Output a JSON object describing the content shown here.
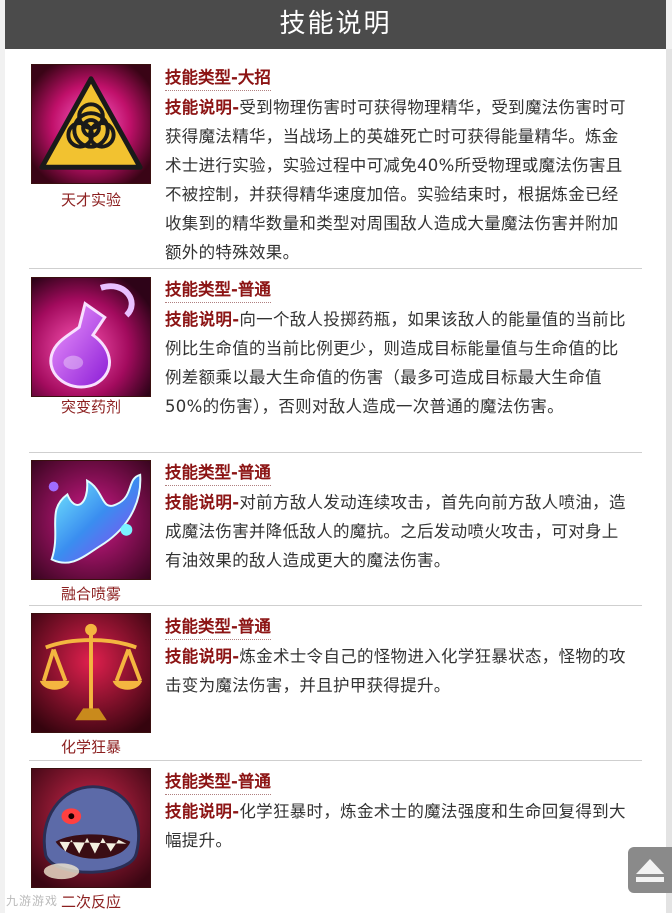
{
  "page": {
    "title": "技能说明"
  },
  "labels": {
    "type_prefix": "技能类型-",
    "desc_prefix": "技能说明-"
  },
  "skills": [
    {
      "name": "天才实验",
      "icon": "biohazard-icon",
      "type": "大招",
      "desc": "受到物理伤害时可获得物理精华，受到魔法伤害时可获得魔法精华，当战场上的英雄死亡时可获得能量精华。炼金术士进行实验，实验过程中可减免40%所受物理或魔法伤害且不被控制，并获得精华速度加倍。实验结束时，根据炼金已经收集到的精华数量和类型对周围敌人造成大量魔法伤害并附加额外的特殊效果。"
    },
    {
      "name": "突变药剂",
      "icon": "potion-flask-icon",
      "type": "普通",
      "desc": "向一个敌人投掷药瓶，如果该敌人的能量值的当前比例比生命值的当前比例更少，则造成目标能量值与生命值的比例差额乘以最大生命值的伤害（最多可造成目标最大生命值50%的伤害），否则对敌人造成一次普通的魔法伤害。"
    },
    {
      "name": "融合喷雾",
      "icon": "splash-icon",
      "type": "普通",
      "desc": "对前方敌人发动连续攻击，首先向前方敌人喷油，造成魔法伤害并降低敌人的魔抗。之后发动喷火攻击，可对身上有油效果的敌人造成更大的魔法伤害。"
    },
    {
      "name": "化学狂暴",
      "icon": "scales-icon",
      "type": "普通",
      "desc": "炼金术士令自己的怪物进入化学狂暴状态，怪物的攻击变为魔法伤害，并且护甲获得提升。"
    },
    {
      "name": "二次反应",
      "icon": "monster-face-icon",
      "type": "普通",
      "desc": "化学狂暴时，炼金术士的魔法强度和生命回复得到大幅提升。"
    }
  ],
  "watermark": "九游游戏",
  "colors": {
    "title_bg": "#4b4b4b",
    "accent": "#8c1414",
    "text": "#333333"
  }
}
